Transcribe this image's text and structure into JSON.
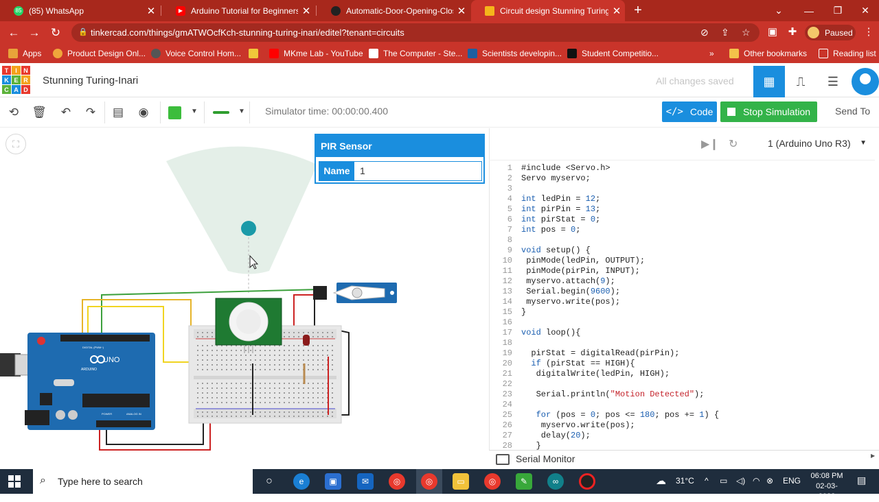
{
  "browser": {
    "tabs": [
      {
        "label": "(85) WhatsApp",
        "icon": "whatsapp-icon",
        "color": "#25d366",
        "badge": "85"
      },
      {
        "label": "Arduino Tutorial for Beginners | A",
        "icon": "youtube-icon",
        "color": "#ff0000"
      },
      {
        "label": "Automatic-Door-Opening-Closin",
        "icon": "github-icon",
        "color": "#222222"
      },
      {
        "label": "Circuit design Stunning Turing-In",
        "icon": "tinkercad-icon",
        "color": "#f5b51b"
      }
    ],
    "new_tab": "+",
    "url": "tinkercad.com/things/gmATWOcfKch-stunning-turing-inari/editel?tenant=circuits",
    "profile_status": "Paused",
    "bookmarks": [
      {
        "label": "Apps",
        "color": "#e8a33a"
      },
      {
        "label": "Product Design Onl...",
        "color": "#f0a63b"
      },
      {
        "label": "Voice Control Hom...",
        "color": "#555555"
      },
      {
        "label": "",
        "color": "#f0c83a"
      },
      {
        "label": "MKme Lab - YouTube",
        "color": "#ff0000"
      },
      {
        "label": "The Computer - Ste...",
        "color": "#ffffff"
      },
      {
        "label": "Scientists developin...",
        "color": "#1f5fa0"
      },
      {
        "label": "Student Competitio...",
        "color": "#111111"
      }
    ],
    "more_bookmarks": "»",
    "other_bookmarks": "Other bookmarks",
    "reading_list": "Reading list"
  },
  "tinkercad": {
    "logo_letters": [
      "TIN",
      "KER",
      "CAD"
    ],
    "project_title": "Stunning Turing-Inari",
    "saved_status": "All changes saved",
    "sim_time": "Simulator time: 00:00:00.400",
    "code_button": "Code",
    "stop_button": "Stop Simulation",
    "send_to": "Send To",
    "device": "1 (Arduino Uno R3)",
    "serial_monitor": "Serial Monitor",
    "component_panel": {
      "title": "PIR Sensor",
      "name_label": "Name",
      "name_value": "1"
    },
    "colors": {
      "accent": "#1a8ede",
      "sim_green": "#33b349",
      "wire_swatch": "#3cbd3c"
    }
  },
  "code": [
    {
      "n": "1",
      "t": "#include <Servo.h>"
    },
    {
      "n": "2",
      "t": "Servo myservo;"
    },
    {
      "n": "3",
      "t": ""
    },
    {
      "n": "4",
      "t": "int ledPin = 12;"
    },
    {
      "n": "5",
      "t": "int pirPin = 13;"
    },
    {
      "n": "6",
      "t": "int pirStat = 0;"
    },
    {
      "n": "7",
      "t": "int pos = 0;"
    },
    {
      "n": "8",
      "t": ""
    },
    {
      "n": "9",
      "t": "void setup() {"
    },
    {
      "n": "10",
      "t": " pinMode(ledPin, OUTPUT);"
    },
    {
      "n": "11",
      "t": " pinMode(pirPin, INPUT);"
    },
    {
      "n": "12",
      "t": " myservo.attach(9);"
    },
    {
      "n": "13",
      "t": " Serial.begin(9600);"
    },
    {
      "n": "14",
      "t": " myservo.write(pos);"
    },
    {
      "n": "15",
      "t": "}"
    },
    {
      "n": "16",
      "t": ""
    },
    {
      "n": "17",
      "t": "void loop(){"
    },
    {
      "n": "18",
      "t": ""
    },
    {
      "n": "19",
      "t": "  pirStat = digitalRead(pirPin);"
    },
    {
      "n": "20",
      "t": "  if (pirStat == HIGH){"
    },
    {
      "n": "21",
      "t": "   digitalWrite(ledPin, HIGH);"
    },
    {
      "n": "22",
      "t": ""
    },
    {
      "n": "23",
      "t": "   Serial.println(\"Motion Detected\");"
    },
    {
      "n": "24",
      "t": ""
    },
    {
      "n": "25",
      "t": "   for (pos = 0; pos <= 180; pos += 1) {"
    },
    {
      "n": "26",
      "t": "    myservo.write(pos);"
    },
    {
      "n": "27",
      "t": "    delay(20);"
    },
    {
      "n": "28",
      "t": "   }"
    }
  ],
  "circuit": {
    "arduino_labels": {
      "brand": "ARDUINO",
      "model": "UNO",
      "digital": "DIGITAL (PWM~)",
      "power": "POWER",
      "analog": "ANALOG IN"
    }
  },
  "taskbar": {
    "search_placeholder": "Type here to search",
    "temperature": "31°C",
    "language": "ENG",
    "time": "06:08 PM",
    "date": "02-03-2022"
  }
}
